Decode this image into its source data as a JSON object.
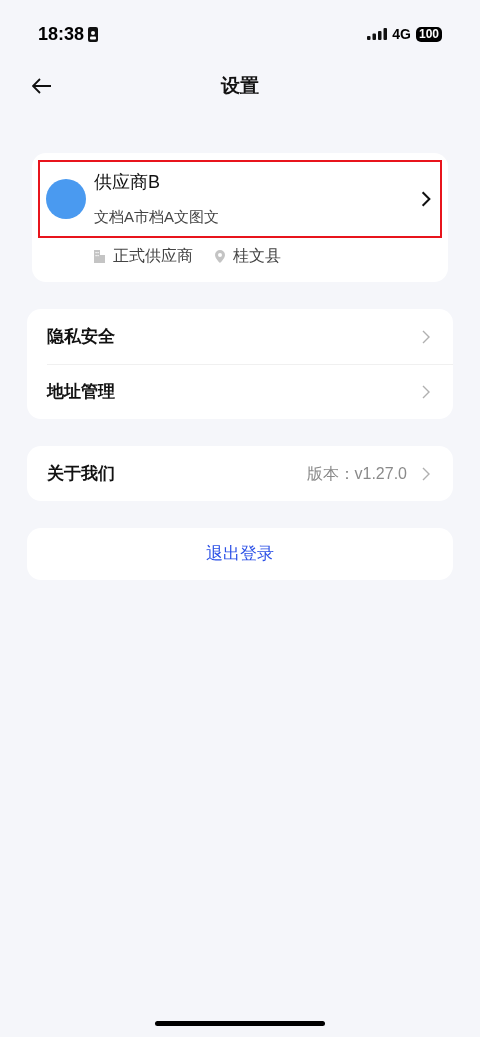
{
  "status_bar": {
    "time": "18:38",
    "network": "4G",
    "battery": "100"
  },
  "nav": {
    "title": "设置"
  },
  "profile": {
    "name": "供应商B",
    "address": "文档A市档A文图文",
    "highlighted": true,
    "tags": [
      {
        "kind": "building",
        "label": "正式供应商"
      },
      {
        "kind": "location",
        "label": "桂文县"
      }
    ]
  },
  "groups": [
    {
      "items": [
        {
          "label": "隐私安全"
        },
        {
          "label": "地址管理"
        }
      ]
    },
    {
      "items": [
        {
          "label": "关于我们",
          "value": "版本：v1.27.0"
        }
      ]
    }
  ],
  "logout": {
    "label": "退出登录"
  }
}
